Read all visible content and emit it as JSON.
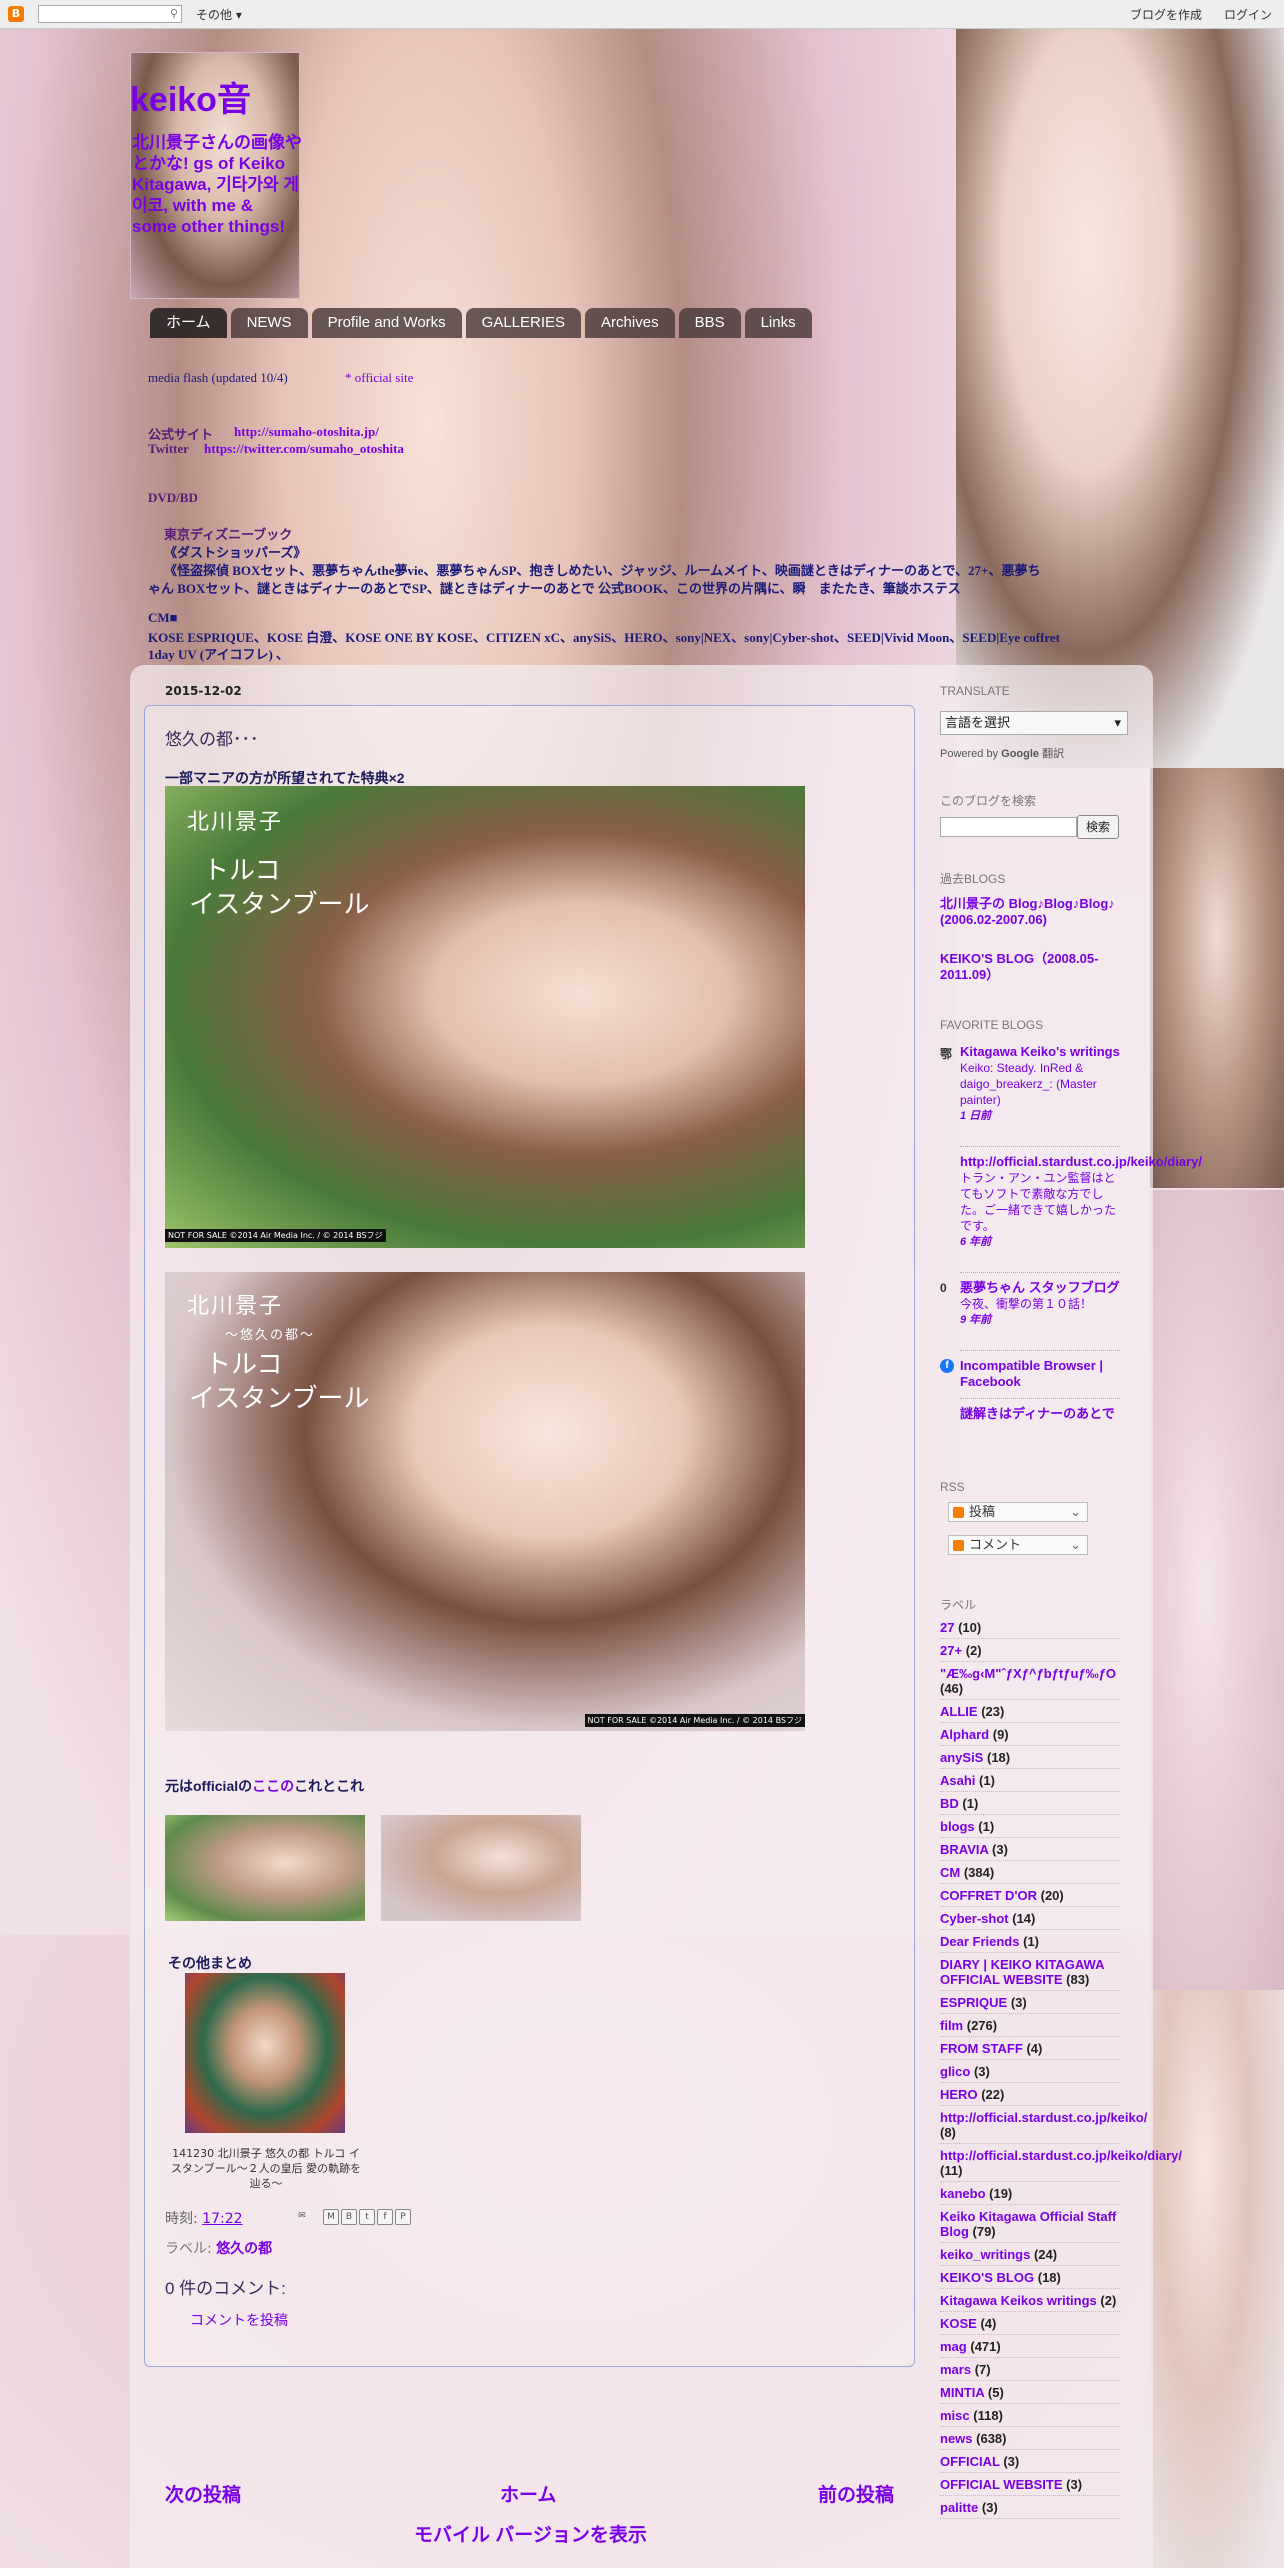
{
  "navbar": {
    "more": "その他 ▾",
    "create_blog": "ブログを作成",
    "login": "ログイン"
  },
  "header": {
    "title": "keiko音",
    "description": "北川景子さんの画像やとかな! gs of Keiko Kitagawa, 기타가와 게이코, with me & some other things!"
  },
  "tabs": [
    "ホーム",
    "NEWS",
    "Profile and Works",
    "GALLERIES",
    "Archives",
    "BBS",
    "Links"
  ],
  "header_text": {
    "media_line": "media flash (updated 10/4)",
    "official_link": "* official site",
    "site_label": "公式サイト",
    "site_url": "http://sumaho-otoshita.jp/",
    "twitter_label": "Twitter",
    "twitter_url": "https://twitter.com/sumaho_otoshita",
    "dvd_heading": "DVD/BD",
    "dvd_sub": "東京ディズニーブック",
    "dvd_line1": "《ダストショッパーズ》",
    "dvd_line2": "《怪盗探偵 BOXセット、悪夢ちゃんthe夢vie、悪夢ちゃんSP、抱きしめたい、ジャッジ、ルームメイト、映画謎ときはディナーのあとで、27+、悪夢ち",
    "dvd_line3": "ゃん BOXセット、謎ときはディナーのあとでSP、謎ときはディナーのあとで 公式BOOK、この世界の片隅に、瞬　またたき、筆談ホステス",
    "cm_heading": "CM■",
    "cm_line1": "KOSE ESPRIQUE、KOSE 白澄、KOSE ONE BY KOSE、CITIZEN xC、anySiS、HERO、sony|NEX、sony|Cyber-shot、SEED|Vivid Moon、SEED|Eye coffret",
    "cm_line2": "1day UV (アイコフレ) 、"
  },
  "post": {
    "date": "2015-12-02",
    "title": "悠久の都･･･",
    "subtitle": "一部マニアの方が所望されてた特典×2",
    "photo_name": "北川景子",
    "photo_title_1": "トルコ",
    "photo_title_2": "イスタンブール",
    "photo1_caption": "NOT FOR SALE ©2014 Air Media Inc. / © 2014 BSフジ",
    "photo2_caption": "NOT FOR SALE ©2014 Air Media Inc. / © 2014 BSフジ",
    "photo2_sub": "～悠久の都～",
    "source_prefix": "元はofficialの",
    "source_link": "ここの",
    "source_suffix": "これとこれ",
    "summary_title": "その他まとめ",
    "summary_caption": "141230 北川景子 悠久の都 トルコ イスタンブール～２人の皇后 愛の軌跡を辿る～",
    "time_label": "時刻:",
    "time_value": "17:22",
    "labels_label": "ラベル:",
    "labels_value": "悠久の都",
    "comments_heading": "0 件のコメント:",
    "comment_link": "コメントを投稿",
    "share_icons": [
      "M",
      "B",
      "t",
      "f",
      "P"
    ]
  },
  "pager": {
    "newer": "次の投稿",
    "home": "ホーム",
    "older": "前の投稿",
    "mobile": "モバイル バージョンを表示"
  },
  "sidebar": {
    "translate_heading": "TRANSLATE",
    "lang_select": "言語を選択",
    "powered_by": "Powered by",
    "google": "Google",
    "translate_word": "翻訳",
    "search_heading": "このブログを検索",
    "search_button": "検索",
    "past_heading": "過去BLOGS",
    "past_links": [
      "北川景子の Blog♪Blog♪Blog♪ (2006.02-2007.06)",
      "KEIKO'S BLOG（2008.05-2011.09）"
    ],
    "fav_heading": "FAVORITE BLOGS",
    "favorites": [
      {
        "icon": "鄂",
        "title": "Kitagawa Keiko's writings",
        "snippet": "Keiko: Steady. InRed & daigo_breakerz_: (Master painter)",
        "age": "1 日前"
      },
      {
        "icon": "",
        "title": "http://official.stardust.co.jp/keiko/diary/",
        "snippet": "トラン・アン・ユン監督はとてもソフトで素敵な方でした。ご一緒できて嬉しかったです。",
        "age": "6 年前"
      },
      {
        "icon": "0",
        "title": "悪夢ちゃん スタッフブログ",
        "snippet": "今夜、衝撃の第１０話！",
        "age": "9 年前"
      },
      {
        "icon": "f",
        "title": "Incompatible Browser | Facebook",
        "snippet": "",
        "age": ""
      },
      {
        "icon": "",
        "title": "謎解きはディナーのあとで",
        "snippet": "",
        "age": ""
      }
    ],
    "rss_heading": "RSS",
    "rss_posts": "投稿",
    "rss_comments": "コメント",
    "labels_heading": "ラベル",
    "labels": [
      {
        "name": "27",
        "count": "(10)"
      },
      {
        "name": "27+",
        "count": "(2)"
      },
      {
        "name": "\"Æ‰g‹M\"ˆƒXƒ^ƒbƒtƒuƒ‰ƒO",
        "count": "(46)"
      },
      {
        "name": "ALLIE",
        "count": "(23)"
      },
      {
        "name": "Alphard",
        "count": "(9)"
      },
      {
        "name": "anySiS",
        "count": "(18)"
      },
      {
        "name": "Asahi",
        "count": "(1)"
      },
      {
        "name": "BD",
        "count": "(1)"
      },
      {
        "name": "blogs",
        "count": "(1)"
      },
      {
        "name": "BRAVIA",
        "count": "(3)"
      },
      {
        "name": "CM",
        "count": "(384)"
      },
      {
        "name": "COFFRET D'OR",
        "count": "(20)"
      },
      {
        "name": "Cyber-shot",
        "count": "(14)"
      },
      {
        "name": "Dear Friends",
        "count": "(1)"
      },
      {
        "name": "DIARY | KEIKO KITAGAWA OFFICIAL WEBSITE",
        "count": "(83)"
      },
      {
        "name": "ESPRIQUE",
        "count": "(3)"
      },
      {
        "name": "film",
        "count": "(276)"
      },
      {
        "name": "FROM STAFF",
        "count": "(4)"
      },
      {
        "name": "glico",
        "count": "(3)"
      },
      {
        "name": "HERO",
        "count": "(22)"
      },
      {
        "name": "http://official.stardust.co.jp/keiko/",
        "count": "(8)"
      },
      {
        "name": "http://official.stardust.co.jp/keiko/diary/",
        "count": "(11)"
      },
      {
        "name": "kanebo",
        "count": "(19)"
      },
      {
        "name": "Keiko Kitagawa Official Staff Blog",
        "count": "(79)"
      },
      {
        "name": "keiko_writings",
        "count": "(24)"
      },
      {
        "name": "KEIKO'S BLOG",
        "count": "(18)"
      },
      {
        "name": "Kitagawa Keikos writings",
        "count": "(2)"
      },
      {
        "name": "KOSE",
        "count": "(4)"
      },
      {
        "name": "mag",
        "count": "(471)"
      },
      {
        "name": "mars",
        "count": "(7)"
      },
      {
        "name": "MINTIA",
        "count": "(5)"
      },
      {
        "name": "misc",
        "count": "(118)"
      },
      {
        "name": "news",
        "count": "(638)"
      },
      {
        "name": "OFFICIAL",
        "count": "(3)"
      },
      {
        "name": "OFFICIAL WEBSITE",
        "count": "(3)"
      },
      {
        "name": "palitte",
        "count": "(3)"
      }
    ]
  }
}
